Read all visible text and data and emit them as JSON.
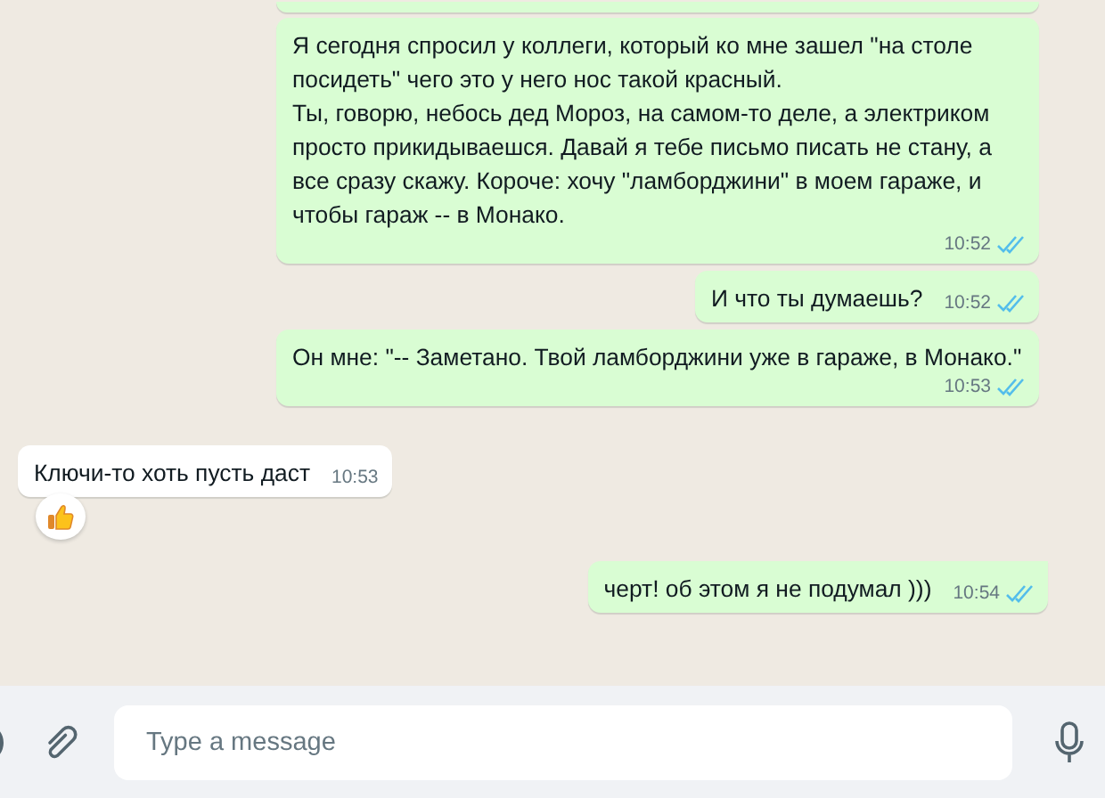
{
  "messages": [
    {
      "kind": "fragment"
    },
    {
      "kind": "outgoing",
      "text": "Я сегодня спросил у коллеги, который ко мне зашел \"на столе посидеть\" чего это у него нос такой красный.\nТы, говорю, небось дед Мороз, на самом-то деле, а электриком просто прикидываешся. Давай я тебе письмо писать не стану, а все сразу скажу. Короче: хочу \"ламборджини\" в моем гараже, и чтобы гараж -- в Монако.",
      "time": "10:52",
      "read": true,
      "tail": false,
      "reaction": false
    },
    {
      "kind": "outgoing",
      "text": "И что ты думаешь?",
      "time": "10:52",
      "read": true,
      "tail": false,
      "reaction": false
    },
    {
      "kind": "outgoing",
      "text": "Он мне: \"-- Заметано. Твой ламборджини уже в гараже, в Монако.\"",
      "time": "10:53",
      "read": true,
      "tail": false,
      "reaction": false
    },
    {
      "kind": "incoming",
      "text": "Ключи-то хоть пусть даст",
      "time": "10:53",
      "tail": false,
      "reaction": true
    },
    {
      "kind": "outgoing",
      "text": "черт! об этом я не подумал )))",
      "time": "10:54",
      "read": true,
      "tail": true,
      "reaction": false
    }
  ],
  "composer": {
    "placeholder": "Type a message"
  }
}
